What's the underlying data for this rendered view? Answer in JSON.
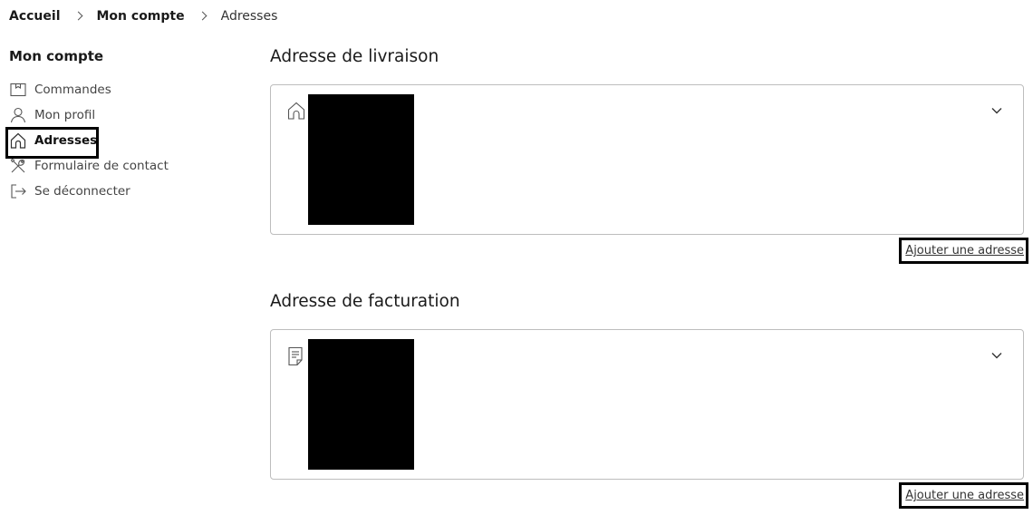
{
  "breadcrumb": {
    "home": "Accueil",
    "account": "Mon compte",
    "current": "Adresses"
  },
  "sidebar": {
    "title": "Mon compte",
    "items": [
      {
        "label": "Commandes",
        "icon": "orders-icon"
      },
      {
        "label": "Mon profil",
        "icon": "user-icon"
      },
      {
        "label": "Adresses",
        "icon": "home-icon",
        "active": true
      },
      {
        "label": "Formulaire de contact",
        "icon": "tools-icon"
      },
      {
        "label": "Se déconnecter",
        "icon": "logout-icon"
      }
    ]
  },
  "shipping": {
    "title": "Adresse de livraison",
    "icon": "home-icon",
    "add_label": "Ajouter une adresse"
  },
  "billing": {
    "title": "Adresse de facturation",
    "icon": "document-icon",
    "add_label": "Ajouter une adresse"
  },
  "colors": {
    "text": "#1a1a1a",
    "border": "#bdbdbd",
    "highlight": "#000000"
  }
}
